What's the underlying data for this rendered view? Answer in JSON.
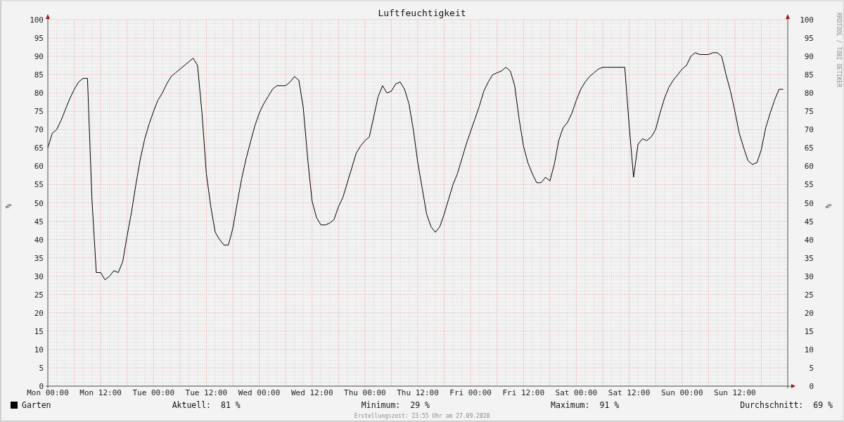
{
  "graph": {
    "right_axis": {
      "label": "%",
      "ticks": [
        "100",
        "95",
        "90",
        "85",
        "80",
        "75",
        "70",
        "65",
        "60",
        "55",
        "50",
        "45",
        "40",
        "35",
        "30",
        "25",
        "20",
        "15",
        "10",
        "5",
        "0"
      ]
    },
    "chart_data": {
      "type": "line",
      "title": "Luftfeuchtigkeit",
      "ylabel": "%",
      "ylim": [
        0,
        100
      ],
      "grid": true,
      "categories": [
        "Mon 00:00",
        null,
        null,
        null,
        null,
        null,
        null,
        null,
        null,
        null,
        null,
        null,
        "Mon 12:00",
        null,
        null,
        null,
        null,
        null,
        null,
        null,
        null,
        null,
        null,
        null,
        "Tue 00:00",
        null,
        null,
        null,
        null,
        null,
        null,
        null,
        null,
        null,
        null,
        null,
        "Tue 12:00",
        null,
        null,
        null,
        null,
        null,
        null,
        null,
        null,
        null,
        null,
        null,
        "Wed 00:00",
        null,
        null,
        null,
        null,
        null,
        null,
        null,
        null,
        null,
        null,
        null,
        "Wed 12:00",
        null,
        null,
        null,
        null,
        null,
        null,
        null,
        null,
        null,
        null,
        null,
        "Thu 00:00",
        null,
        null,
        null,
        null,
        null,
        null,
        null,
        null,
        null,
        null,
        null,
        "Thu 12:00",
        null,
        null,
        null,
        null,
        null,
        null,
        null,
        null,
        null,
        null,
        null,
        "Fri 00:00",
        null,
        null,
        null,
        null,
        null,
        null,
        null,
        null,
        null,
        null,
        null,
        "Fri 12:00",
        null,
        null,
        null,
        null,
        null,
        null,
        null,
        null,
        null,
        null,
        null,
        "Sat 00:00",
        null,
        null,
        null,
        null,
        null,
        null,
        null,
        null,
        null,
        null,
        null,
        "Sat 12:00",
        null,
        null,
        null,
        null,
        null,
        null,
        null,
        null,
        null,
        null,
        null,
        "Sun 00:00",
        null,
        null,
        null,
        null,
        null,
        null,
        null,
        null,
        null,
        null,
        null,
        "Sun 12:00",
        null,
        null,
        null,
        null,
        null,
        null,
        null,
        null,
        null,
        null,
        null
      ],
      "yticks": [
        100,
        95,
        90,
        85,
        80,
        75,
        70,
        65,
        60,
        55,
        50,
        45,
        40,
        35,
        30,
        25,
        20,
        15,
        10,
        5,
        0
      ],
      "series": [
        {
          "name": "Garten",
          "color": "#000000",
          "values": [
            65,
            69,
            70,
            72.5,
            75.5,
            78.5,
            81,
            83,
            84,
            84,
            51.5,
            31,
            31,
            29,
            30,
            31.5,
            31,
            34,
            41,
            47.5,
            55,
            62,
            67.5,
            71.5,
            75,
            78,
            80,
            82.5,
            84.5,
            85.5,
            86.5,
            87.5,
            88.5,
            89.5,
            87.5,
            74.5,
            58,
            49,
            42,
            40,
            38.5,
            38.5,
            43,
            50,
            56.5,
            62,
            66.5,
            71,
            74.5,
            77,
            79,
            81,
            82,
            82,
            82,
            83,
            84.5,
            83.5,
            76,
            62,
            50.5,
            46,
            44,
            44,
            44.5,
            45.5,
            49,
            51.5,
            55.5,
            59.5,
            63.5,
            65.5,
            67,
            68,
            73.5,
            79,
            82,
            80,
            80.5,
            82.5,
            83,
            81,
            77,
            70,
            61,
            54,
            47,
            43.5,
            42,
            43.5,
            47,
            51,
            55,
            58,
            62,
            66,
            69.5,
            73,
            76.5,
            80.5,
            83,
            85,
            85.5,
            86,
            87,
            86,
            82,
            73,
            65.5,
            61,
            58,
            55.5,
            55.5,
            57,
            56,
            60.5,
            67,
            70.5,
            72,
            74.5,
            78,
            81,
            83,
            84.5,
            85.5,
            86.5,
            87,
            87,
            87,
            87,
            87,
            87,
            71,
            57,
            66,
            67.5,
            67,
            68,
            70,
            74.5,
            78.5,
            81.5,
            83.5,
            85,
            86.5,
            87.5,
            90,
            91,
            90.5,
            90.5,
            90.5,
            91,
            91,
            90,
            85,
            80.5,
            75,
            69,
            65,
            61.5,
            60.5,
            61,
            64.5,
            70.5,
            74.5,
            78,
            81,
            81
          ]
        }
      ]
    }
  },
  "legend": {
    "stats": [
      {
        "label": "Aktuell:",
        "value": "81 %"
      },
      {
        "label": "Minimum:",
        "value": "29 %"
      },
      {
        "label": "Maximum:",
        "value": "91 %"
      },
      {
        "label": "Durchschnitt:",
        "value": "69 %"
      }
    ]
  },
  "footer": "Erstellungszeit: 23:55 Uhr am 27.09.2020",
  "stamp": "RRDTOOL / TOBI OETIKER"
}
